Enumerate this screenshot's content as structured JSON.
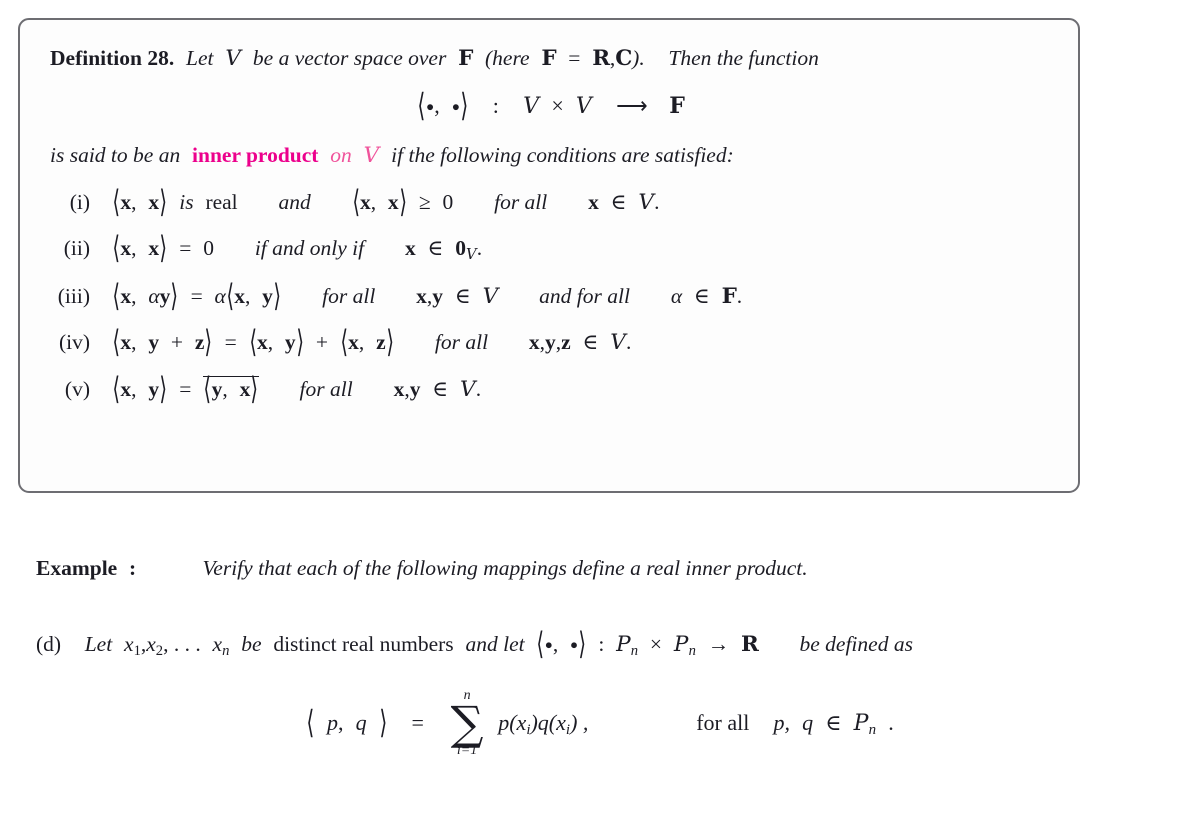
{
  "document": {
    "definition": {
      "label": "Definition 28.",
      "intro_before": "Let",
      "space_symbol": "V",
      "intro_middle": "be a vector space over",
      "field_symbol": "F",
      "field_note_open": "(here",
      "field_equals": "=",
      "field_reals": "R",
      "field_comma": ",",
      "field_complex": "C",
      "field_note_close": ").",
      "intro_after": "Then the function",
      "display_equation": {
        "pairing": "⟨ • , • ⟩",
        "colon": ":",
        "domain_left": "V",
        "times": "×",
        "domain_right": "V",
        "arrow": "⟶",
        "codomain": "F"
      },
      "said_prefix": "is said to be an",
      "said_keyword": "inner product",
      "said_on": "on",
      "said_space": "V",
      "said_suffix": "if the following conditions are satisfied:",
      "axioms": [
        {
          "num": "(i)",
          "parts": [
            "⟨ x , x ⟩",
            "is",
            "real",
            "and",
            "⟨ x , x ⟩",
            "≥",
            "0",
            "for all",
            "x ∈ V."
          ]
        },
        {
          "num": "(ii)",
          "parts": [
            "⟨ x , x ⟩",
            "=",
            "0",
            "if and only if",
            "x ∈ 0",
            "V",
            "."
          ]
        },
        {
          "num": "(iii)",
          "parts": [
            "⟨ x , αy ⟩",
            "=",
            "α⟨ x , y ⟩",
            "for all",
            "x, y ∈ V",
            "and for all",
            "α ∈ F."
          ]
        },
        {
          "num": "(iv)",
          "parts": [
            "⟨ x , y + z ⟩",
            "=",
            "⟨ x , y ⟩ + ⟨ x , z ⟩",
            "for all",
            "x, y, z ∈ V."
          ]
        },
        {
          "num": "(v)",
          "parts": [
            "⟨ x , y ⟩",
            "=",
            "⟨ y , x ⟩ (conjugate)",
            "for all",
            "x, y ∈ V."
          ]
        }
      ]
    },
    "example": {
      "label": "Example",
      "mark": ":",
      "text": "Verify that each of the following mappings define a real inner product."
    },
    "part_d": {
      "label": "(d)",
      "t1": "Let",
      "vars": "x",
      "sub1": "1",
      "comma1": ",",
      "var2": "x",
      "sub2": "2",
      "dots": ", . . .",
      "var_n": "x",
      "sub_n": "n",
      "t2": "be",
      "t3": "distinct real numbers",
      "t4": "and let",
      "pairing": "⟨ • , • ⟩",
      "colon": ":",
      "poly_left": "P",
      "poly_left_sub": "n",
      "times": "×",
      "poly_right": "P",
      "poly_right_sub": "n",
      "arrow": "→",
      "codomain": "R",
      "t5": "be defined as"
    },
    "final_equation": {
      "lhs": "⟨ p , q ⟩",
      "equals": "=",
      "sum_symbol": "∑",
      "sum_upper": "n",
      "sum_lower": "i=1",
      "summand_p": "p(x",
      "summand_p_sub": "i",
      "summand_mid": ")q(x",
      "summand_q_sub": "i",
      "summand_close": ") ,",
      "for_all": "for all",
      "members": "p, q ∈ P",
      "members_sub": "n",
      "period": "."
    }
  },
  "style": {
    "accent_strong": "#ec008c",
    "accent_soft": "#f0539b",
    "text_color": "#1c1c24",
    "box_border": "#6d6d72",
    "page_background": "#ffffff"
  }
}
